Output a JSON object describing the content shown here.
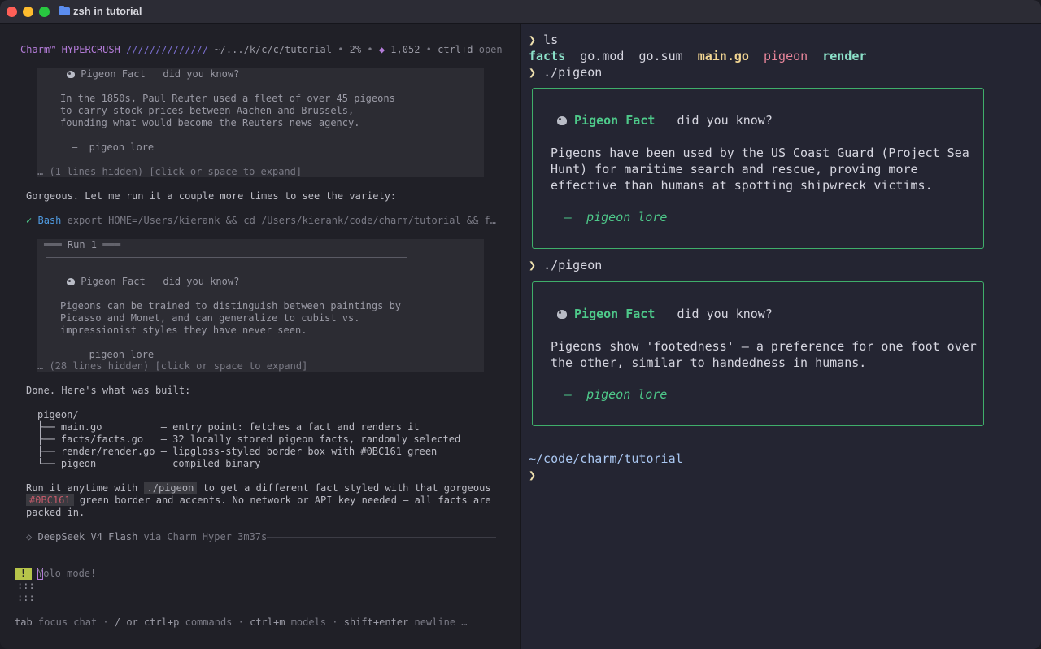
{
  "window": {
    "title": "zsh in tutorial"
  },
  "left": {
    "status": {
      "brand": "Charm™",
      "product": "HYPERCRUSH",
      "slashes": "//////////////",
      "path": "~/.../k/c/c/tutorial",
      "percent": "2%",
      "tokens": "1,052",
      "hint_key": "ctrl+d",
      "hint_label": "open"
    },
    "block1": {
      "header_fact": "Pigeon Fact",
      "header_question": "did you know?",
      "lines": [
        "In the 1850s, Paul Reuter used a fleet of over 45 pigeons",
        "to carry stock prices between Aachen and Brussels,",
        "founding what would become the Reuters news agency."
      ],
      "signature": "—  pigeon lore",
      "hidden": "… (1 lines hidden) [click or space to expand]"
    },
    "message1": "Gorgeous. Let me run it a couple more times to see the variety:",
    "tool": {
      "check": "✓",
      "name": "Bash",
      "command": "export HOME=/Users/kierank && cd /Users/kierank/code/charm/tutorial && f…"
    },
    "block2": {
      "run_label": "═══ Run 1 ═══",
      "header_fact": "Pigeon Fact",
      "header_question": "did you know?",
      "lines": [
        "Pigeons can be trained to distinguish between paintings by",
        "Picasso and Monet, and can generalize to cubist vs.",
        "impressionist styles they have never seen."
      ],
      "signature": "—  pigeon lore",
      "hidden": "… (28 lines hidden) [click or space to expand]"
    },
    "summary_title": "Done. Here's what was built:",
    "tree": [
      "pigeon/",
      "├── main.go          — entry point: fetches a fact and renders it",
      "├── facts/facts.go   — 32 locally stored pigeon facts, randomly selected",
      "├── render/render.go — lipgloss-styled border box with #0BC161 green",
      "└── pigeon           — compiled binary"
    ],
    "run_text_1": "Run it anytime with",
    "run_code": "./pigeon",
    "run_text_2": "to get a different fact styled with that gorgeous",
    "run_color_code": "#0BC161",
    "run_text_3": "green border and accents. No network or API key needed — all facts are",
    "run_text_4": "packed in.",
    "model": {
      "diamond": "◇",
      "name": "DeepSeek V4 Flash",
      "via": "via Charm Hyper 3m37s"
    },
    "input": {
      "warn": "!",
      "placeholder": "Yolo mode!",
      "dots1": ":::",
      "dots2": ":::"
    },
    "help": {
      "k1": "tab",
      "l1": "focus chat",
      "k2": "/ or ctrl+p",
      "l2": "commands",
      "k3": "ctrl+m",
      "l3": "models",
      "k4": "shift+enter",
      "l4": "newline",
      "more": "…"
    }
  },
  "right": {
    "prompt_symbol": "❯",
    "cmd_ls": "ls",
    "ls_items": [
      "facts",
      "go.mod",
      "go.sum",
      "main.go",
      "pigeon",
      "render"
    ],
    "cmd_run": "./pigeon",
    "fact1": {
      "title": "Pigeon Fact",
      "question": "did you know?",
      "lines": [
        "Pigeons have been used by the US Coast Guard (Project Sea",
        "Hunt) for maritime search and rescue, proving more",
        "effective than humans at spotting shipwreck victims."
      ],
      "dash": "—",
      "lore": "pigeon lore"
    },
    "fact2": {
      "title": "Pigeon Fact",
      "question": "did you know?",
      "lines": [
        "Pigeons show 'footedness' — a preference for one foot over",
        "the other, similar to handedness in humans."
      ],
      "dash": "—",
      "lore": "pigeon lore"
    },
    "cwd": "~/code/charm/tutorial"
  },
  "colors": {
    "accent_green": "#0BC161",
    "purple": "#b47cd9",
    "bash_blue": "#4f9ae0"
  }
}
